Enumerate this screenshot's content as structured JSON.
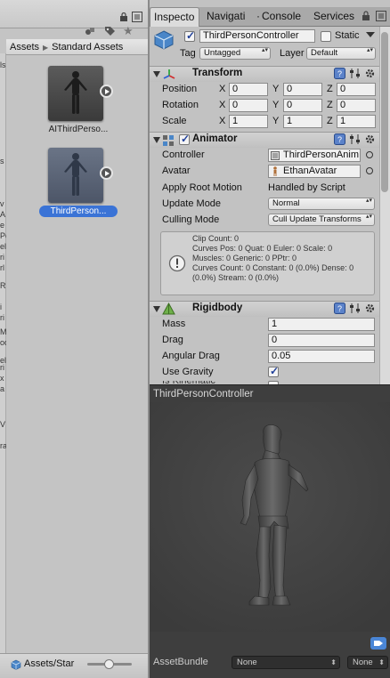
{
  "project": {
    "breadcrumb": [
      "Assets",
      "Standard Assets"
    ],
    "assets": [
      {
        "name": "AIThirdPerso...",
        "selected": false
      },
      {
        "name": "ThirdPerson...",
        "selected": true
      }
    ],
    "bottom_path": "Assets/Star",
    "left_edge_chars": [
      "ls",
      "s",
      "v",
      "A",
      "e",
      "Pe",
      "el",
      "ri",
      "rl",
      "R",
      "i",
      "ri",
      "M",
      "od",
      "el",
      "ri",
      "x",
      "a",
      "V",
      "ra"
    ]
  },
  "tabs": [
    "Inspecto",
    "Navigati",
    "Console",
    "Services"
  ],
  "gameobject": {
    "name": "ThirdPersonController",
    "static_label": "Static",
    "tag_label": "Tag",
    "tag_value": "Untagged",
    "layer_label": "Layer",
    "layer_value": "Default"
  },
  "transform": {
    "title": "Transform",
    "rows": [
      {
        "label": "Position",
        "x": "0",
        "y": "0",
        "z": "0"
      },
      {
        "label": "Rotation",
        "x": "0",
        "y": "0",
        "z": "0"
      },
      {
        "label": "Scale",
        "x": "1",
        "y": "1",
        "z": "1"
      }
    ],
    "axis_labels": [
      "X",
      "Y",
      "Z"
    ]
  },
  "animator": {
    "title": "Animator",
    "controller_label": "Controller",
    "controller_value": "ThirdPersonAnim",
    "avatar_label": "Avatar",
    "avatar_value": "EthanAvatar",
    "root_motion_label": "Apply Root Motion",
    "root_motion_value": "Handled by Script",
    "update_mode_label": "Update Mode",
    "update_mode_value": "Normal",
    "culling_label": "Culling Mode",
    "culling_value": "Cull Update Transforms",
    "info_lines": [
      "Clip Count: 0",
      "Curves Pos: 0 Quat: 0 Euler: 0 Scale: 0",
      "Muscles: 0 Generic: 0 PPtr: 0",
      "Curves Count: 0 Constant: 0 (0.0%) Dense: 0",
      "(0.0%) Stream: 0 (0.0%)"
    ]
  },
  "rigidbody": {
    "title": "Rigidbody",
    "mass_label": "Mass",
    "mass_value": "1",
    "drag_label": "Drag",
    "drag_value": "0",
    "angular_drag_label": "Angular Drag",
    "angular_drag_value": "0.05",
    "use_gravity_label": "Use Gravity",
    "use_gravity": true
  },
  "preview": {
    "title": "ThirdPersonController",
    "assetbundle_label": "AssetBundle",
    "assetbundle_value": "None",
    "variant_value": "None"
  },
  "colors": {
    "selection": "#3a73d6",
    "inspector_bg": "#c2c2c2",
    "preview_bg": "#434343"
  }
}
